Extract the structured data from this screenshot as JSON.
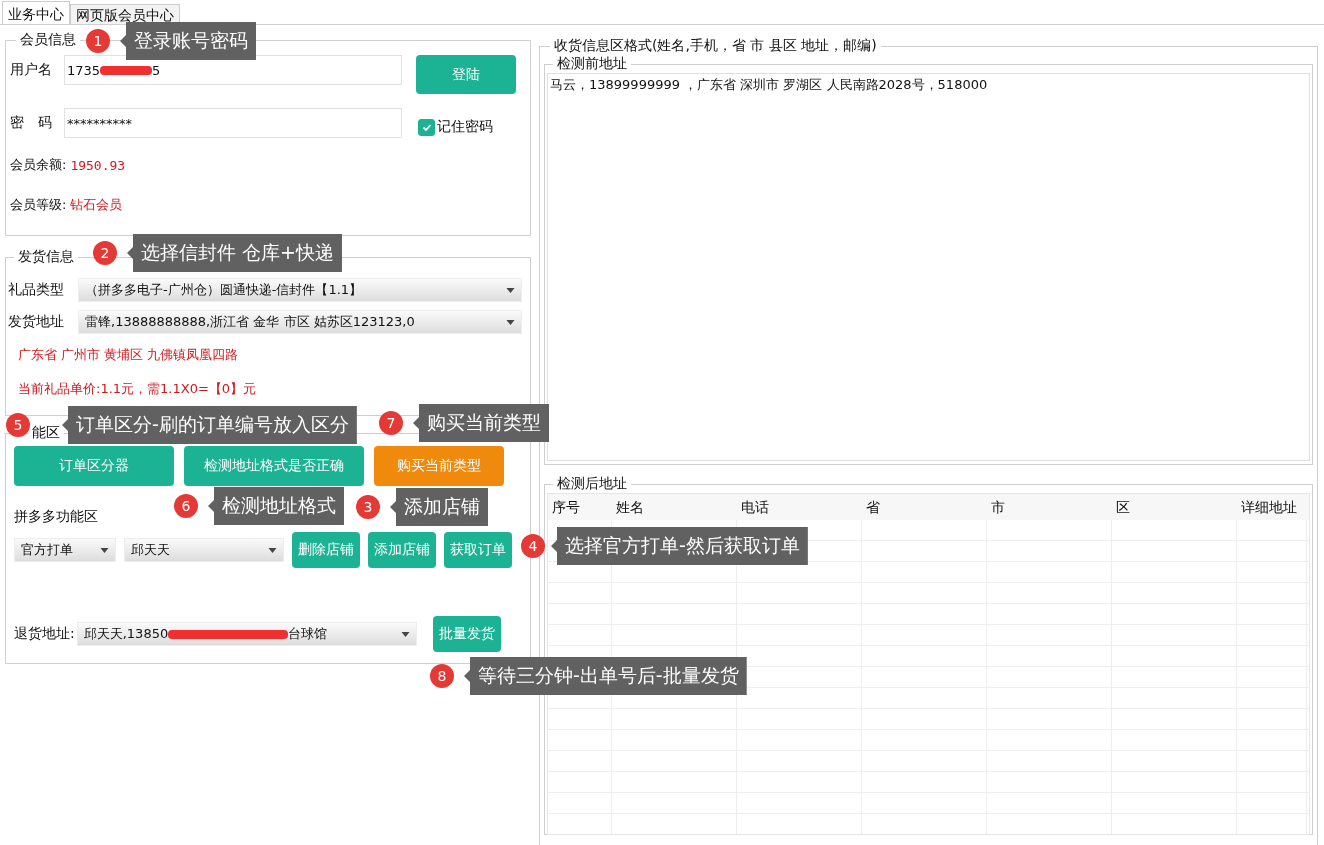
{
  "tabs": [
    {
      "label": "业务中心",
      "selected": true
    },
    {
      "label": "网页版会员中心",
      "selected": false
    }
  ],
  "member_info": {
    "title": "会员信息",
    "username_label": "用户名",
    "username_start": "1735",
    "username_end": "5",
    "password_label": "密　码",
    "password_value": "**********",
    "login_button": "登陆",
    "remember": {
      "label": "记住密码",
      "checked": true
    },
    "balance_label": "会员余额:",
    "balance_value": "1950.93",
    "level_label": "会员等级:",
    "level_value": "钻石会员"
  },
  "shipping_info": {
    "title": "发货信息",
    "gift_type_label": "礼品类型",
    "gift_type_value": "（拼多多电子-广州仓）圆通快递-信封件【1.1】",
    "sender_label": "发货地址",
    "sender_value": "雷锋,13888888888,浙江省 金华 市区 姑苏区123123,0",
    "warehouse_address": "广东省 广州市 黄埔区 九佛镇凤凰四路",
    "price_note": "当前礼品单价:1.1元，需1.1X0=【0】元"
  },
  "functions": {
    "title": "能区",
    "buttons": [
      {
        "label": "订单区分器",
        "kind": "primary"
      },
      {
        "label": "检测地址格式是否正确",
        "kind": "primary"
      },
      {
        "label": "购买当前类型",
        "kind": "warning"
      }
    ],
    "pdd_title": "拼多多功能区",
    "print_mode": "官方打单",
    "shop": "邱天天",
    "shop_buttons": [
      "删除店铺",
      "添加店铺",
      "获取订单"
    ],
    "return_label": "退货地址:",
    "return_start": "邱天天,13850",
    "return_end": "台球馆",
    "ship_button": "批量发货"
  },
  "receiver_format": {
    "title": "收货信息区格式(姓名,手机，省 市 县区 地址，邮编)",
    "before": {
      "title": "检测前地址",
      "value": "马云，13899999999 ，广东省 深圳市 罗湖区 人民南路2028号，518000"
    },
    "after": {
      "title": "检测后地址",
      "columns": [
        "序号",
        "姓名",
        "电话",
        "省",
        "市",
        "区",
        "详细地址"
      ]
    }
  },
  "callouts": [
    {
      "number": "1",
      "text": "登录账号密码"
    },
    {
      "number": "2",
      "text": "选择信封件 仓库+快递"
    },
    {
      "number": "5",
      "text": "订单区分-刷的订单编号放入区分"
    },
    {
      "number": "7",
      "text": "购买当前类型"
    },
    {
      "number": "6",
      "text": "检测地址格式"
    },
    {
      "number": "3",
      "text": "添加店铺"
    },
    {
      "number": "4",
      "text": "选择官方打单-然后获取订单"
    },
    {
      "number": "8",
      "text": "等待三分钟-出单号后-批量发货"
    }
  ]
}
